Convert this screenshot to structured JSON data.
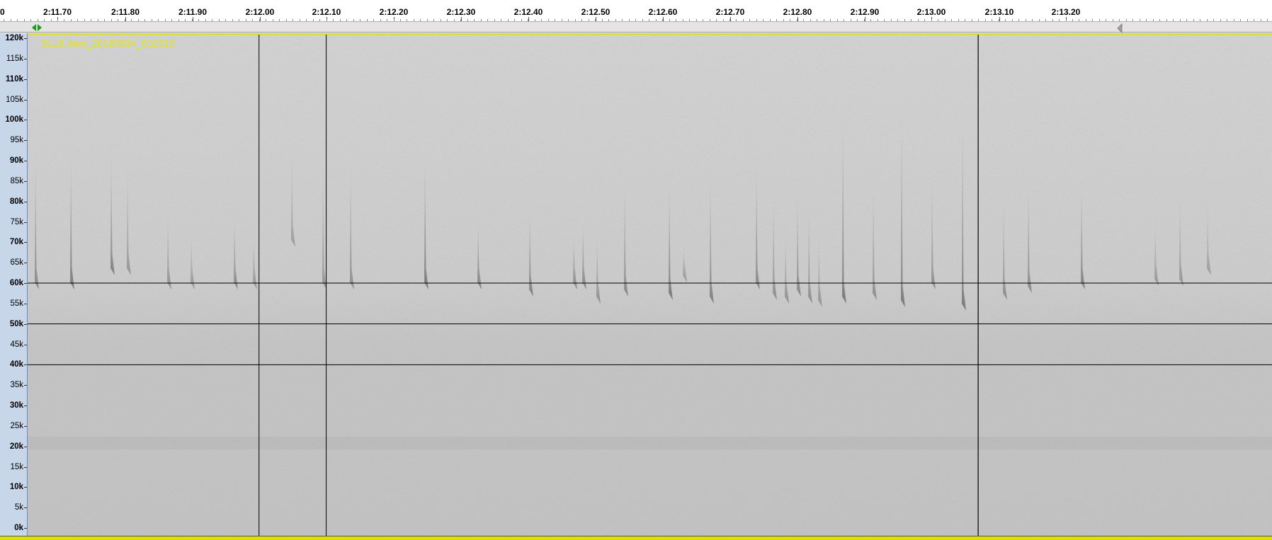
{
  "ruler": {
    "labels": [
      "0",
      "2:11.70",
      "2:11.80",
      "2:11.90",
      "2:12.00",
      "2:12.10",
      "2:12.20",
      "2:12.30",
      "2:12.40",
      "2:12.50",
      "2:12.60",
      "2:12.70",
      "2:12.80",
      "2:12.90",
      "2:13.00",
      "2:13.10",
      "2:13.20"
    ]
  },
  "track": {
    "name": "BL18.4am_20180624_012310",
    "name_color": "#e6e600"
  },
  "frequency_axis": {
    "labels": [
      "120k",
      "115k",
      "110k",
      "105k",
      "100k",
      "95k",
      "90k",
      "85k",
      "80k",
      "75k",
      "70k",
      "65k",
      "60k",
      "55k",
      "50k",
      "45k",
      "40k",
      "35k",
      "30k",
      "25k",
      "20k",
      "15k",
      "10k",
      "5k",
      "0k"
    ],
    "major": [
      "120k",
      "110k",
      "100k",
      "90k",
      "80k",
      "70k",
      "60k",
      "50k",
      "40k",
      "30k",
      "20k",
      "10k",
      "0k"
    ],
    "max_khz": 120
  },
  "grid": {
    "horizontal_khz": [
      60,
      50,
      40
    ],
    "vertical_times": [
      "2:12.00",
      "2:12.10"
    ],
    "color": "#000000"
  },
  "selection": {
    "start_time": "2:11.65",
    "end_time": "2:13.07",
    "edge_color": "#2a8a2a"
  },
  "icons": {
    "start_marker": "play-head-marker-icon",
    "end_marker": "end-marker-icon"
  }
}
